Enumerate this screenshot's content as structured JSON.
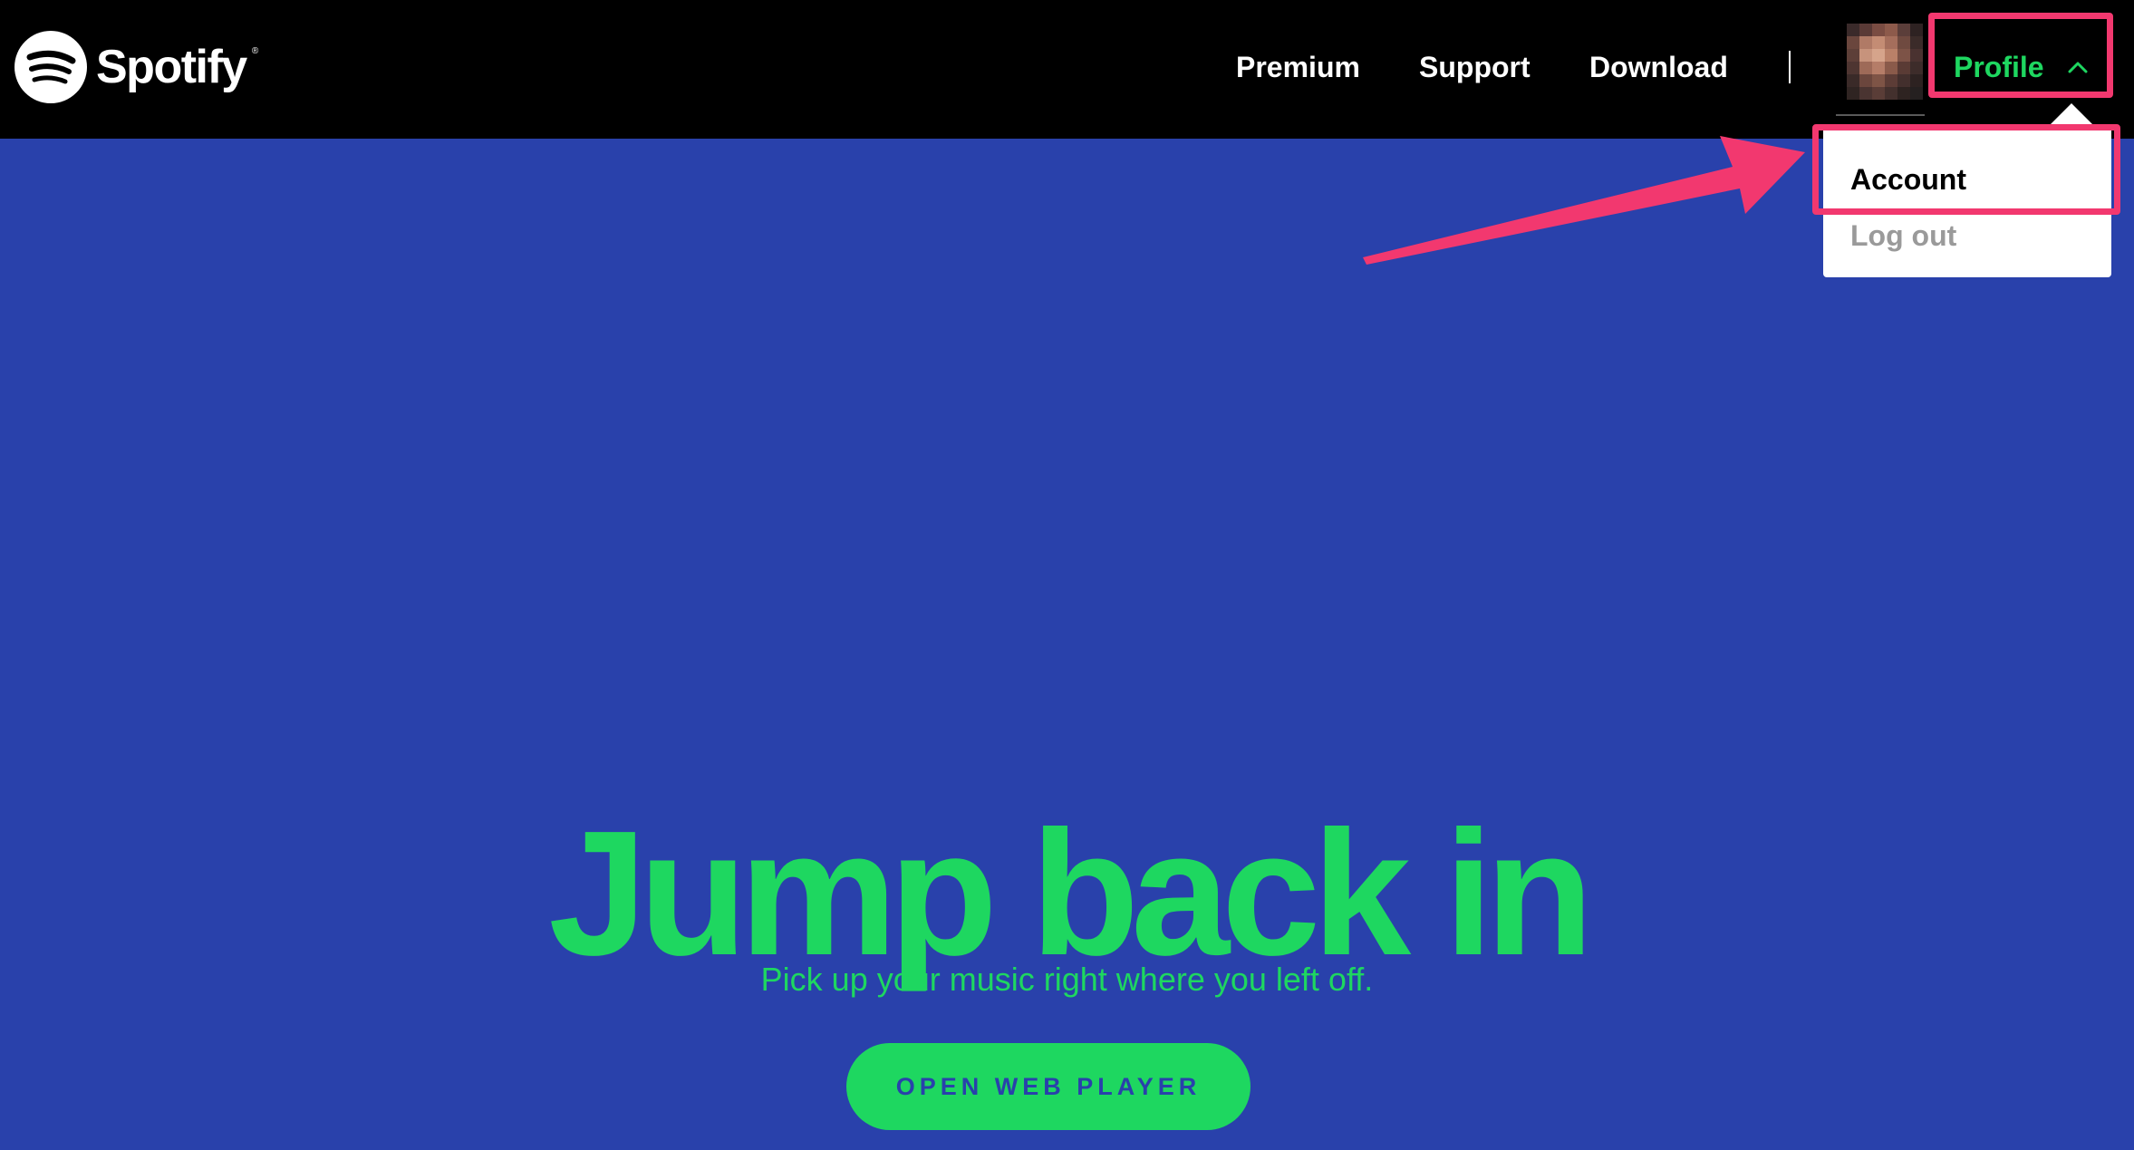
{
  "colors": {
    "navbar_bg": "#000000",
    "hero_bg": "#2941ab",
    "accent_green": "#1ed760",
    "annotation_pink": "#f2386f"
  },
  "brand": {
    "name": "Spotify",
    "registered_mark": "®",
    "icon": "spotify-logo-icon"
  },
  "nav": {
    "premium": "Premium",
    "support": "Support",
    "download": "Download",
    "profile": "Profile",
    "profile_icon": "chevron-up-icon",
    "avatar_icon": "user-avatar"
  },
  "dropdown": {
    "items": [
      {
        "label": "Account",
        "highlighted": true
      },
      {
        "label": "Log out",
        "highlighted": false
      }
    ]
  },
  "annotation": {
    "type": "arrow",
    "points_to": "Account"
  },
  "hero": {
    "title": "Jump back in",
    "subtitle": "Pick up your music right where you left off.",
    "button": "OPEN WEB PLAYER"
  }
}
